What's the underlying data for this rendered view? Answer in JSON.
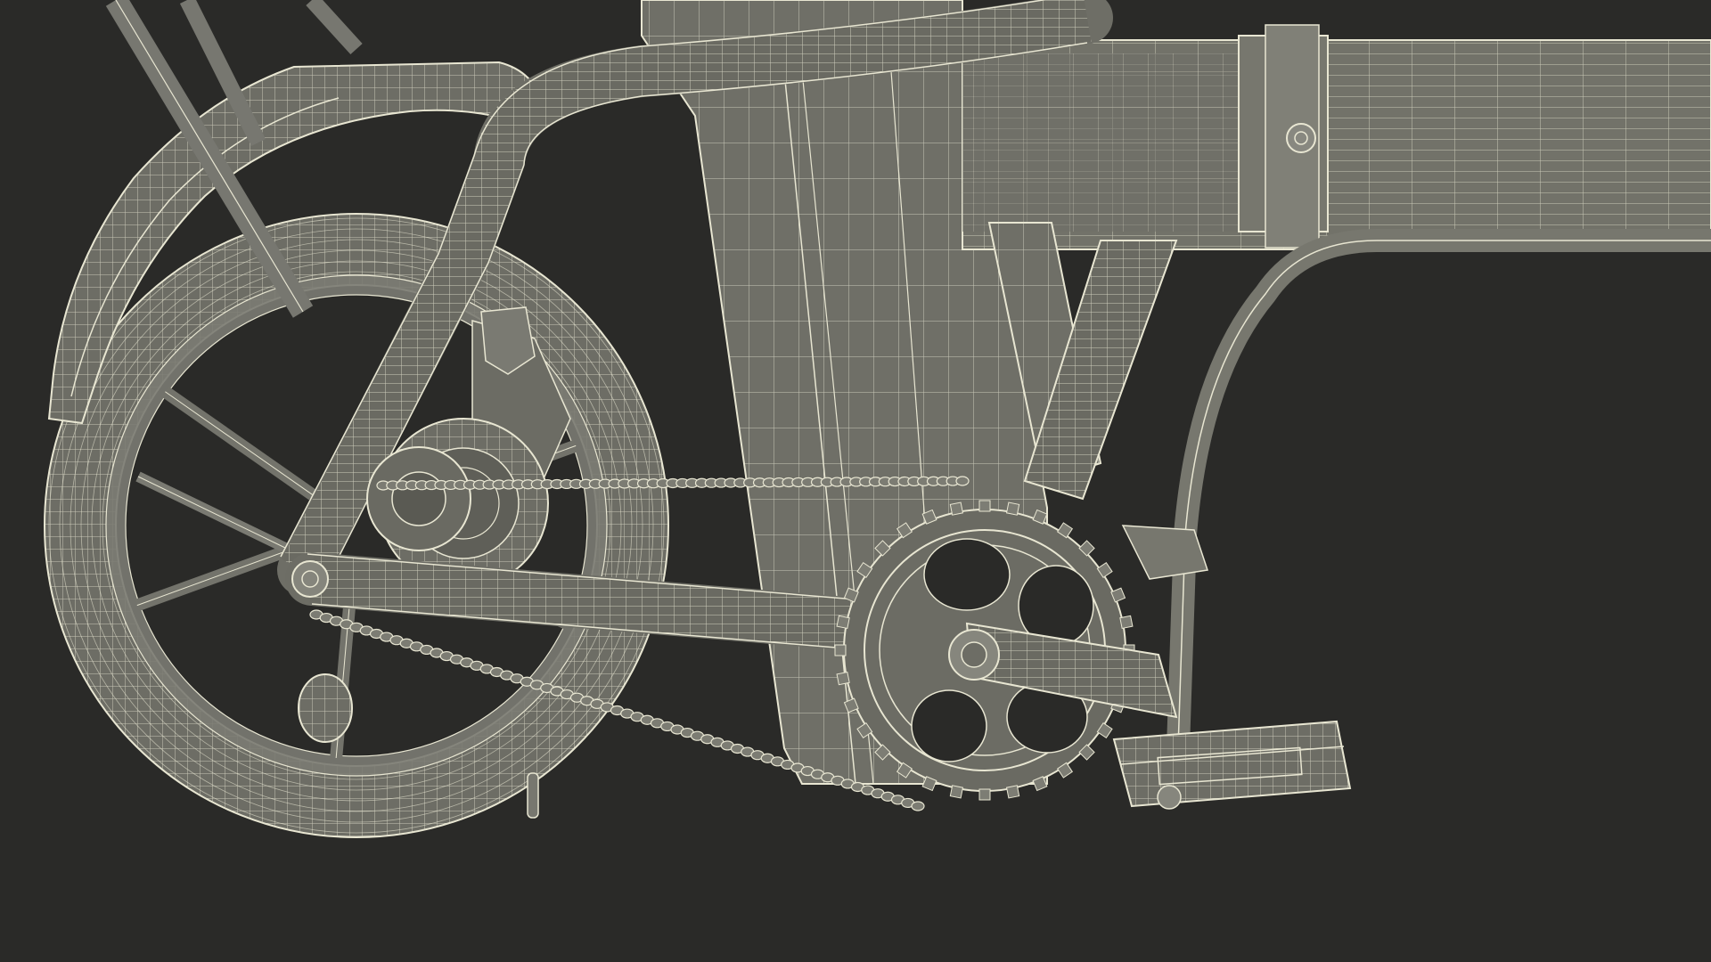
{
  "scene": {
    "subject": "wireframe-render",
    "colors": {
      "background": "#2a2a28",
      "surface": "#6b6b63",
      "surface_light": "#7d7d74",
      "surface_dark": "#55554e",
      "wire": "#e8e6d2"
    },
    "chain_link_count": 120,
    "chainring_tooth_count": 32
  }
}
